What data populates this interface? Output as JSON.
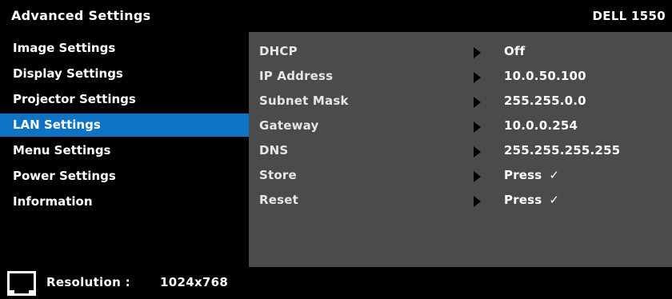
{
  "header": {
    "title": "Advanced Settings",
    "model": "DELL 1550"
  },
  "menu": {
    "selected_index": 3,
    "items": [
      {
        "label": "Image Settings"
      },
      {
        "label": "Display Settings"
      },
      {
        "label": "Projector Settings"
      },
      {
        "label": "LAN Settings"
      },
      {
        "label": "Menu Settings"
      },
      {
        "label": "Power Settings"
      },
      {
        "label": "Information"
      }
    ]
  },
  "lan_settings": {
    "rows": [
      {
        "label": "DHCP",
        "value": "Off",
        "check": ""
      },
      {
        "label": "IP Address",
        "value": "10.0.50.100",
        "check": ""
      },
      {
        "label": "Subnet Mask",
        "value": "255.255.0.0",
        "check": ""
      },
      {
        "label": "Gateway",
        "value": "10.0.0.254",
        "check": ""
      },
      {
        "label": "DNS",
        "value": "255.255.255.255",
        "check": ""
      },
      {
        "label": "Store",
        "value": "Press",
        "check": "✓"
      },
      {
        "label": "Reset",
        "value": "Press",
        "check": "✓"
      }
    ]
  },
  "status": {
    "label": "Resolution :",
    "value": "1024x768",
    "icon": "resolution-screen-icon"
  },
  "colors": {
    "selected": "#0e73c4",
    "panel": "#4b4b4b",
    "background": "#000000"
  }
}
